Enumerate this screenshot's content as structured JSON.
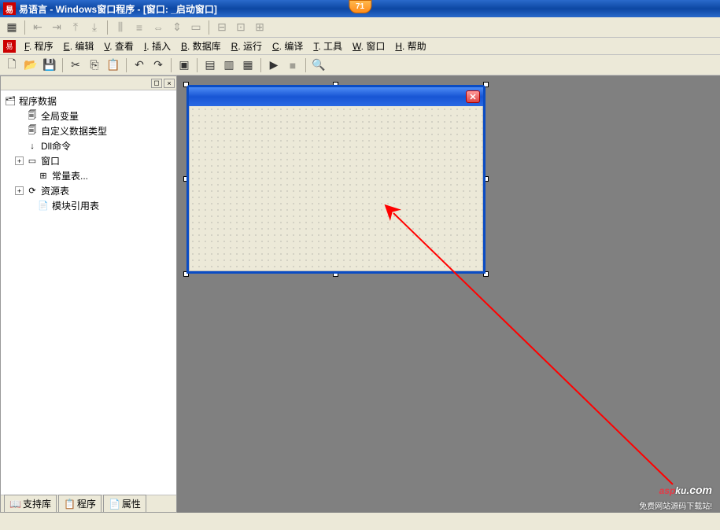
{
  "titlebar": {
    "app_short": "易",
    "title": "易语言 - Windows窗口程序 - [窗口: _启动窗口]",
    "badge": "71"
  },
  "menu": {
    "items": [
      {
        "key": "F",
        "label": ". 程序"
      },
      {
        "key": "E",
        "label": ". 编辑"
      },
      {
        "key": "V",
        "label": ". 查看"
      },
      {
        "key": "I",
        "label": ". 插入"
      },
      {
        "key": "B",
        "label": ". 数据库"
      },
      {
        "key": "R",
        "label": ". 运行"
      },
      {
        "key": "C",
        "label": ". 编译"
      },
      {
        "key": "T",
        "label": ". 工具"
      },
      {
        "key": "W",
        "label": ". 窗口"
      },
      {
        "key": "H",
        "label": ". 帮助"
      }
    ]
  },
  "tree": {
    "root": "程序数据",
    "items": [
      {
        "icon": "🗐",
        "label": "全局变量"
      },
      {
        "icon": "🗐",
        "label": "自定义数据类型"
      },
      {
        "icon": "↓",
        "label": "Dll命令"
      },
      {
        "icon": "▭",
        "label": "窗口",
        "expandable": true
      },
      {
        "icon": "⊞",
        "label": "常量表..."
      },
      {
        "icon": "⟳",
        "label": "资源表",
        "expandable": true
      },
      {
        "icon": "📄",
        "label": "模块引用表"
      }
    ]
  },
  "tabs": {
    "support": "支持库",
    "program": "程序",
    "property": "属性"
  },
  "watermark": {
    "logo_parts": [
      "a",
      "s",
      "p",
      "k",
      "u",
      ".com"
    ],
    "subtitle": "免费网站源码下载站!"
  }
}
